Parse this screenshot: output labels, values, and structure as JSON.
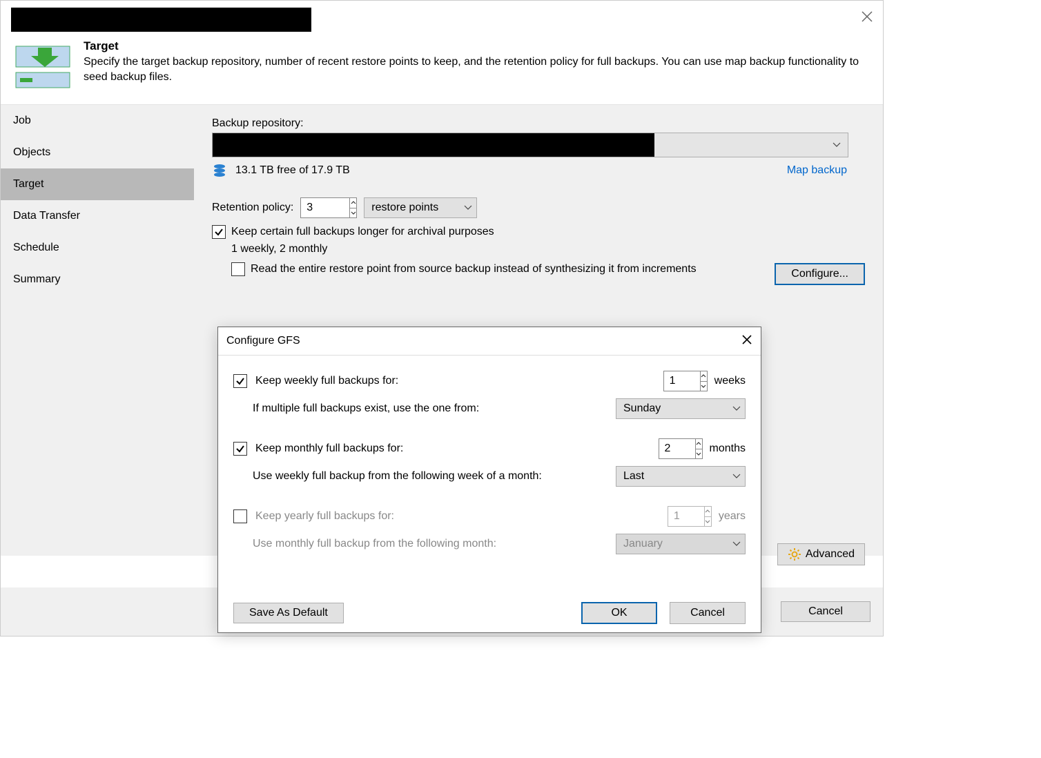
{
  "header": {
    "title": "Target",
    "desc": "Specify the target backup repository, number of recent restore points to keep, and the retention policy for full backups. You can use map backup functionality to seed backup files."
  },
  "nav": {
    "items": [
      "Job",
      "Objects",
      "Target",
      "Data Transfer",
      "Schedule",
      "Summary"
    ],
    "active": "Target"
  },
  "main": {
    "repo_label": "Backup repository:",
    "free_space": "13.1 TB free of 17.9 TB",
    "map_backup": "Map backup",
    "retention_label": "Retention policy:",
    "retention_value": "3",
    "retention_unit": "restore points",
    "gfs_checkbox": "Keep certain full backups longer for archival purposes",
    "gfs_summary": "1 weekly, 2 monthly",
    "read_entire": "Read the entire restore point from source backup instead of synthesizing it from increments",
    "configure_btn": "Configure...",
    "advanced_btn": "Advanced"
  },
  "footer": {
    "cancel": "Cancel"
  },
  "dialog": {
    "title": "Configure GFS",
    "weekly": {
      "checked": true,
      "label": "Keep weekly full backups for:",
      "value": "1",
      "unit": "weeks",
      "sub_label": "If multiple full backups exist, use the one from:",
      "sub_value": "Sunday"
    },
    "monthly": {
      "checked": true,
      "label": "Keep monthly full backups for:",
      "value": "2",
      "unit": "months",
      "sub_label": "Use weekly full backup from the following week of a month:",
      "sub_value": "Last"
    },
    "yearly": {
      "checked": false,
      "label": "Keep yearly full backups for:",
      "value": "1",
      "unit": "years",
      "sub_label": "Use monthly full backup from the following month:",
      "sub_value": "January"
    },
    "save_default": "Save As Default",
    "ok": "OK",
    "cancel": "Cancel"
  }
}
